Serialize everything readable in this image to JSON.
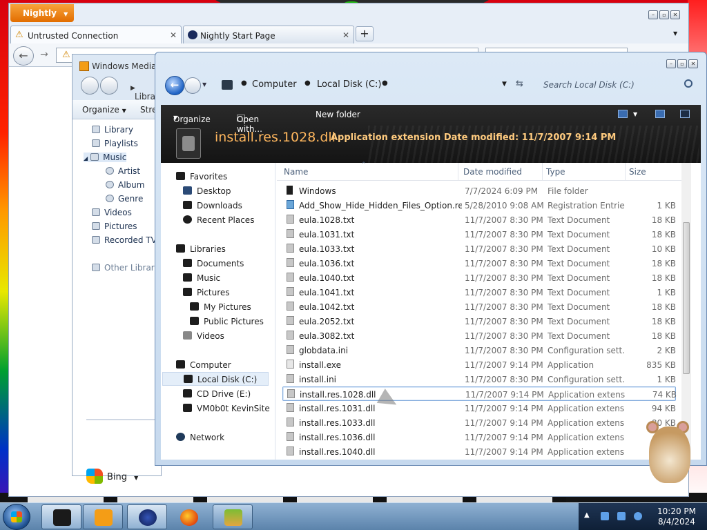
{
  "firefox": {
    "menu_label": "Nightly",
    "tabs": [
      {
        "label": "Untrusted Connection",
        "active": true
      },
      {
        "label": "Nightly Start Page",
        "active": false
      }
    ],
    "new_tab_label": "+"
  },
  "wmp": {
    "title": "Windows Media Player",
    "breadcrumb": "Library",
    "toolbar": {
      "organize": "Organize",
      "stream": "Stream"
    },
    "nav": [
      {
        "label": "Library"
      },
      {
        "label": "Playlists"
      },
      {
        "label": "Music"
      },
      {
        "label": "Artist"
      },
      {
        "label": "Album"
      },
      {
        "label": "Genre"
      },
      {
        "label": "Videos"
      },
      {
        "label": "Pictures"
      },
      {
        "label": "Recorded TV"
      },
      {
        "label": "Other Libraries"
      }
    ],
    "bing_label": "Bing"
  },
  "explorer": {
    "breadcrumb": [
      "Computer",
      "Local Disk (C:)"
    ],
    "search_placeholder": "Search Local Disk (C:)",
    "toolbar": {
      "organize": "Organize",
      "open_with": "Open with...",
      "new_folder": "New folder"
    },
    "details": {
      "file_name": "install.res.1028.dll",
      "info": "Application extension  Date modified: 11/7/2007 9:14 PM"
    },
    "nav": {
      "favorites": "Favorites",
      "desktop": "Desktop",
      "downloads": "Downloads",
      "recent": "Recent Places",
      "libraries": "Libraries",
      "documents": "Documents",
      "music": "Music",
      "pictures": "Pictures",
      "my_pictures": "My Pictures",
      "public_pictures": "Public Pictures",
      "videos": "Videos",
      "computer": "Computer",
      "local_disk": "Local Disk (C:)",
      "cd_drive": "CD Drive (E:)",
      "vm": "VM0b0t KevinSite",
      "network": "Network"
    },
    "columns": {
      "name": "Name",
      "date": "Date modified",
      "type": "Type",
      "size": "Size"
    },
    "rows": [
      {
        "name": "Windows",
        "date": "7/7/2024 6:09 PM",
        "type": "File folder",
        "size": "",
        "kind": "folder"
      },
      {
        "name": "Add_Show_Hide_Hidden_Files_Option.reg",
        "date": "5/28/2010 9:08 AM",
        "type": "Registration Entries",
        "size": "1 KB",
        "kind": "reg"
      },
      {
        "name": "eula.1028.txt",
        "date": "11/7/2007 8:30 PM",
        "type": "Text Document",
        "size": "18 KB",
        "kind": "txt"
      },
      {
        "name": "eula.1031.txt",
        "date": "11/7/2007 8:30 PM",
        "type": "Text Document",
        "size": "18 KB",
        "kind": "txt"
      },
      {
        "name": "eula.1033.txt",
        "date": "11/7/2007 8:30 PM",
        "type": "Text Document",
        "size": "10 KB",
        "kind": "txt"
      },
      {
        "name": "eula.1036.txt",
        "date": "11/7/2007 8:30 PM",
        "type": "Text Document",
        "size": "18 KB",
        "kind": "txt"
      },
      {
        "name": "eula.1040.txt",
        "date": "11/7/2007 8:30 PM",
        "type": "Text Document",
        "size": "18 KB",
        "kind": "txt"
      },
      {
        "name": "eula.1041.txt",
        "date": "11/7/2007 8:30 PM",
        "type": "Text Document",
        "size": "1 KB",
        "kind": "txt"
      },
      {
        "name": "eula.1042.txt",
        "date": "11/7/2007 8:30 PM",
        "type": "Text Document",
        "size": "18 KB",
        "kind": "txt"
      },
      {
        "name": "eula.2052.txt",
        "date": "11/7/2007 8:30 PM",
        "type": "Text Document",
        "size": "18 KB",
        "kind": "txt"
      },
      {
        "name": "eula.3082.txt",
        "date": "11/7/2007 8:30 PM",
        "type": "Text Document",
        "size": "18 KB",
        "kind": "txt"
      },
      {
        "name": "globdata.ini",
        "date": "11/7/2007 8:30 PM",
        "type": "Configuration sett...",
        "size": "2 KB",
        "kind": "ini"
      },
      {
        "name": "install.exe",
        "date": "11/7/2007 9:14 PM",
        "type": "Application",
        "size": "835 KB",
        "kind": "exe"
      },
      {
        "name": "install.ini",
        "date": "11/7/2007 8:30 PM",
        "type": "Configuration sett...",
        "size": "1 KB",
        "kind": "ini"
      },
      {
        "name": "install.res.1028.dll",
        "date": "11/7/2007 9:14 PM",
        "type": "Application extens...",
        "size": "74 KB",
        "kind": "dll",
        "selected": true
      },
      {
        "name": "install.res.1031.dll",
        "date": "11/7/2007 9:14 PM",
        "type": "Application extens...",
        "size": "94 KB",
        "kind": "dll"
      },
      {
        "name": "install.res.1033.dll",
        "date": "11/7/2007 9:14 PM",
        "type": "Application extens...",
        "size": "80 KB",
        "kind": "dll"
      },
      {
        "name": "install.res.1036.dll",
        "date": "11/7/2007 9:14 PM",
        "type": "Application extens...",
        "size": "",
        "kind": "dll"
      },
      {
        "name": "install.res.1040.dll",
        "date": "11/7/2007 9:14 PM",
        "type": "Application extens...",
        "size": "",
        "kind": "dll"
      }
    ]
  },
  "taskbar": {
    "time": "10:20 PM",
    "date": "8/4/2024"
  },
  "colors": {
    "accent_orange": "#e26d00",
    "explorer_dark": "#141414",
    "detail_text": "#ffb75e",
    "selection_border": "#84acdd"
  }
}
